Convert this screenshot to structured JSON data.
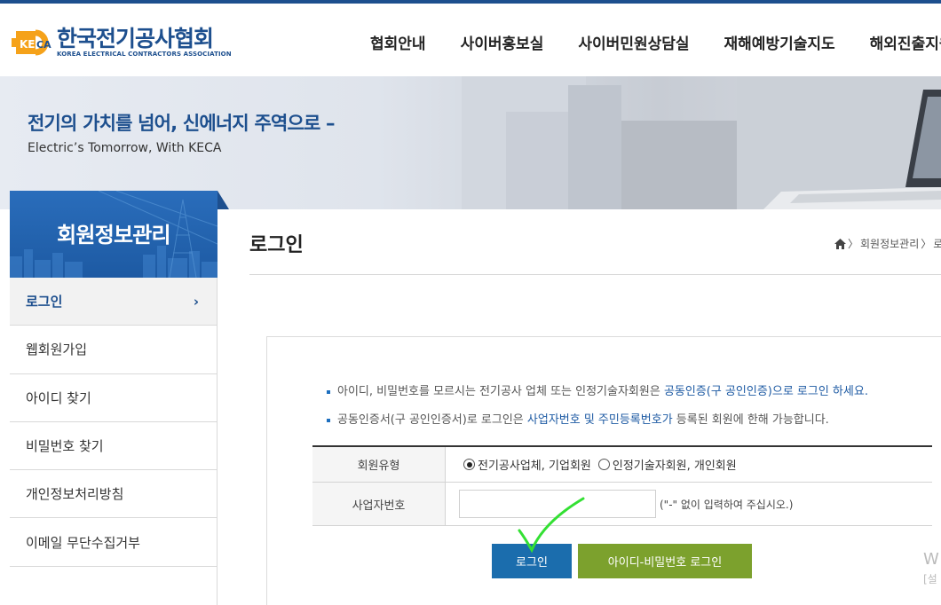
{
  "colors": {
    "brand": "#1d4f8e",
    "login_button": "#1b6dad",
    "idpw_button": "#7ca12d",
    "highlight_text": "#1d5aa3",
    "check_mark": "#33e033"
  },
  "header": {
    "logo": {
      "name": "한국전기공사협회",
      "sub": "KOREA ELECTRICAL CONTRACTORS ASSOCIATION",
      "mark": "KECA"
    },
    "nav": [
      "협회안내",
      "사이버홍보실",
      "사이버민원상담실",
      "재해예방기술지도",
      "해외진출지원"
    ]
  },
  "banner": {
    "title": "전기의 가치를 넘어, 신에너지 주역으로 –",
    "subtitle": "Electric’s Tomorrow, With KECA"
  },
  "sidebar": {
    "title": "회원정보관리",
    "items": [
      {
        "label": "로그인",
        "active": true,
        "chevron": "›"
      },
      {
        "label": "웹회원가입"
      },
      {
        "label": "아이디 찾기"
      },
      {
        "label": "비밀번호 찾기"
      },
      {
        "label": "개인정보처리방침"
      },
      {
        "label": "이메일 무단수집거부"
      }
    ]
  },
  "main": {
    "title": "로그인",
    "breadcrumb": {
      "home_icon": "home-icon",
      "items": [
        "회원정보관리",
        "로그인"
      ]
    },
    "notices": [
      {
        "pre": "아이디, 비밀번호를 모르시는 전기공사 업체 또는 인정기술자회원은 ",
        "em": "공동인증(구 공인인증)으로 로그인 하세요.",
        "post": ""
      },
      {
        "pre": "공동인증서(구 공인인증서)로 로그인은 ",
        "em": "사업자번호 및 주민등록번호가",
        "post": " 등록된 회원에 한해 가능합니다."
      }
    ],
    "form": {
      "member_type_label": "회원유형",
      "member_types": [
        {
          "label": "전기공사업체, 기업회원",
          "checked": true
        },
        {
          "label": "인정기술자회원, 개인회원",
          "checked": false
        }
      ],
      "biz_no_label": "사업자번호",
      "biz_no_value": "",
      "biz_no_hint": "(\"-\" 없이 입력하여 주십시오.)"
    },
    "buttons": {
      "login": "로그인",
      "id_pw_login": "아이디-비밀번호 로그인"
    }
  },
  "watermark": {
    "line1": "W",
    "line2": "[설"
  }
}
